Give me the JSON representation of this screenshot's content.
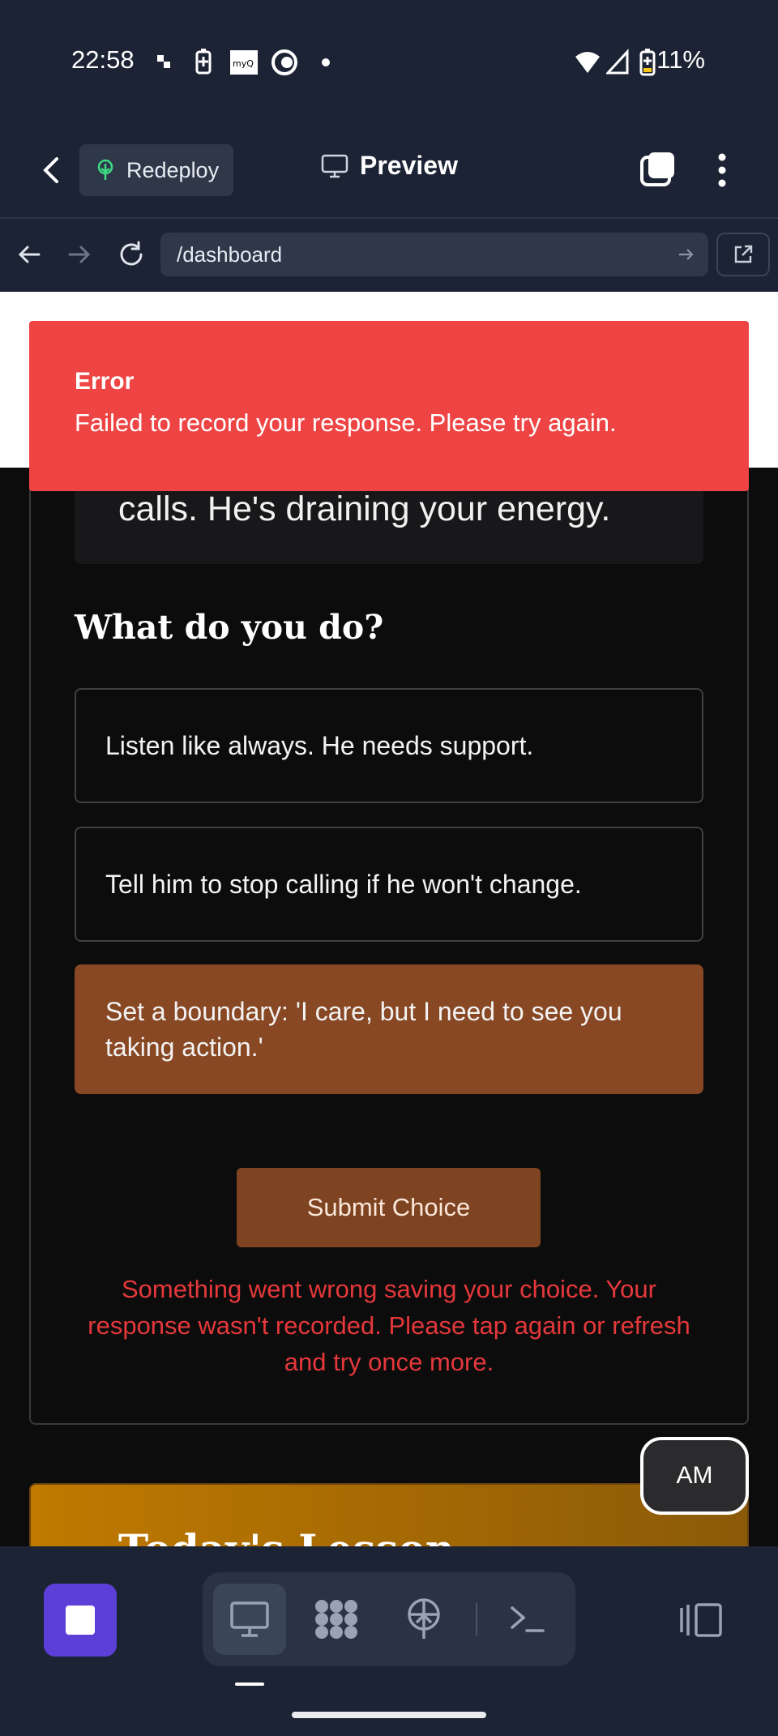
{
  "status_bar": {
    "time": "22:58",
    "battery": "11%"
  },
  "app_bar": {
    "redeploy_label": "Redeploy",
    "preview_label": "Preview"
  },
  "browser": {
    "url": "/dashboard"
  },
  "scenario": {
    "text_fragment": "calls. He's draining your energy."
  },
  "question": "What do you do?",
  "choices": [
    {
      "label": "Listen like always. He needs support.",
      "selected": false
    },
    {
      "label": "Tell him to stop calling if he won't change.",
      "selected": false
    },
    {
      "label": "Set a boundary: 'I care, but I need to see you taking action.'",
      "selected": true
    }
  ],
  "submit_label": "Submit Choice",
  "inline_error": "Something went wrong saving your choice. Your response wasn't recorded. Please tap again or refresh and try once more.",
  "lesson": {
    "title": "Today's Lesson"
  },
  "avatar_initials": "AM",
  "toast": {
    "title": "Error",
    "message": "Failed to record your response. Please try again."
  },
  "colors": {
    "chrome_bg": "#1c2334",
    "page_bg": "#0c0c0d",
    "toast_bg": "#ef4444",
    "selected_choice": "#884824",
    "submit_bg": "#7e4320",
    "error_text": "#e5383b",
    "stop_button": "#5b3fd6",
    "lesson_gradient_start": "#c07a00"
  },
  "icons": [
    "back-chevron-icon",
    "tree-icon",
    "monitor-icon",
    "tabs-icon",
    "more-vert-icon",
    "arrow-left-icon",
    "arrow-right-icon",
    "reload-icon",
    "go-arrow-icon",
    "external-link-icon",
    "stop-icon",
    "desktop-icon",
    "grid-icon",
    "deploy-icon",
    "terminal-icon",
    "layout-icon"
  ]
}
